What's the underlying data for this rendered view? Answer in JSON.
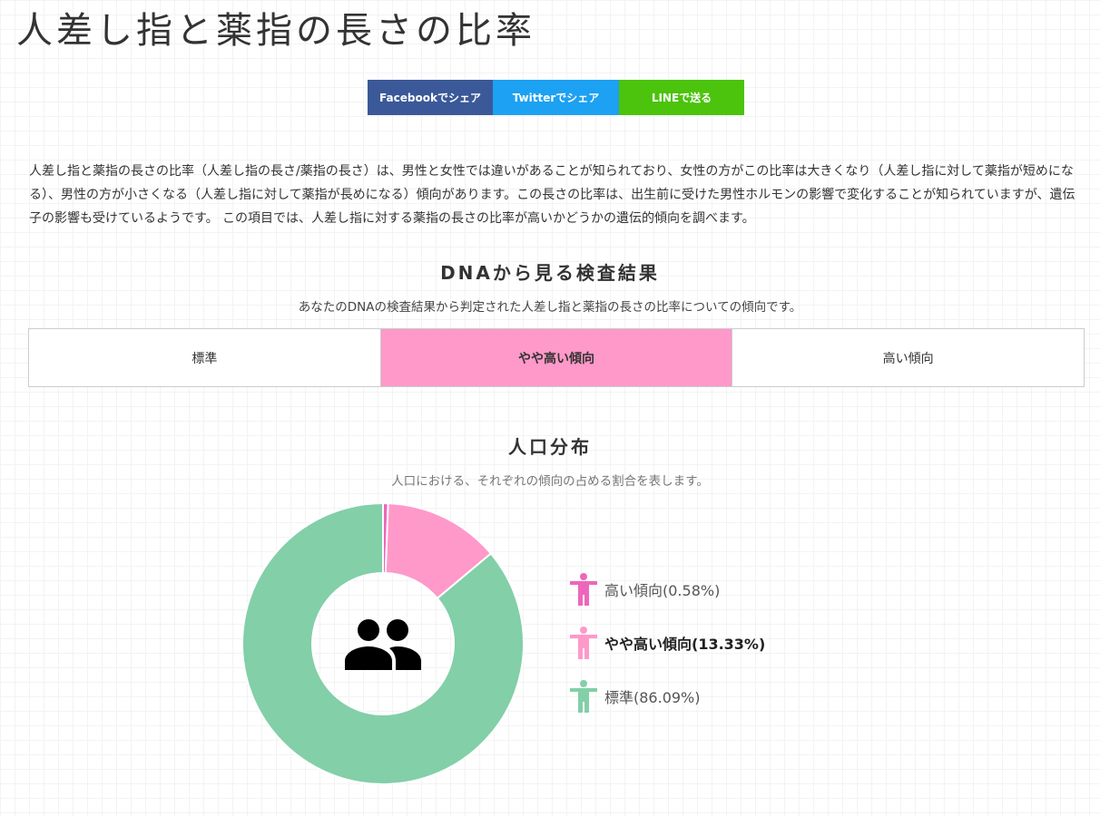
{
  "page": {
    "title": "人差し指と薬指の長さの比率"
  },
  "share": {
    "facebook_label": "Facebookでシェア",
    "twitter_label": "Twitterでシェア",
    "line_label": "LINEで送る"
  },
  "intro": {
    "text": "人差し指と薬指の長さの比率（人差し指の長さ/薬指の長さ）は、男性と女性では違いがあることが知られており、女性の方がこの比率は大きくなり（人差し指に対して薬指が短めになる）、男性の方が小さくなる（人差し指に対して薬指が長めになる）傾向があります。この長さの比率は、出生前に受けた男性ホルモンの影響で変化することが知られていますが、遺伝子の影響も受けているようです。 この項目では、人差し指に対する薬指の長さの比率が高いかどうかの遺伝的傾向を調べます。"
  },
  "result": {
    "heading": "DNAから見る検査結果",
    "subtitle": "あなたのDNAの検査結果から判定された人差し指と薬指の長さの比率についての傾向です。",
    "tabs": [
      {
        "label": "標準"
      },
      {
        "label": "やや高い傾向"
      },
      {
        "label": "高い傾向"
      }
    ],
    "active_tab": "やや高い傾向"
  },
  "population": {
    "heading": "人口分布",
    "subtitle": "人口における、それぞれの傾向の占める割合を表します。"
  },
  "chart_data": {
    "type": "pie",
    "donut": true,
    "center_icon": "people-icon",
    "categories": [
      "高い傾向",
      "やや高い傾向",
      "標準"
    ],
    "values": [
      0.58,
      13.33,
      86.09
    ],
    "colors": [
      "#ee66bb",
      "#ff99c9",
      "#82cfa8"
    ],
    "legend_labels": [
      "高い傾向(0.58%)",
      "やや高い傾向(13.33%)",
      "標準(86.09%)"
    ],
    "legend_placement": "right",
    "highlighted": "やや高い傾向"
  }
}
